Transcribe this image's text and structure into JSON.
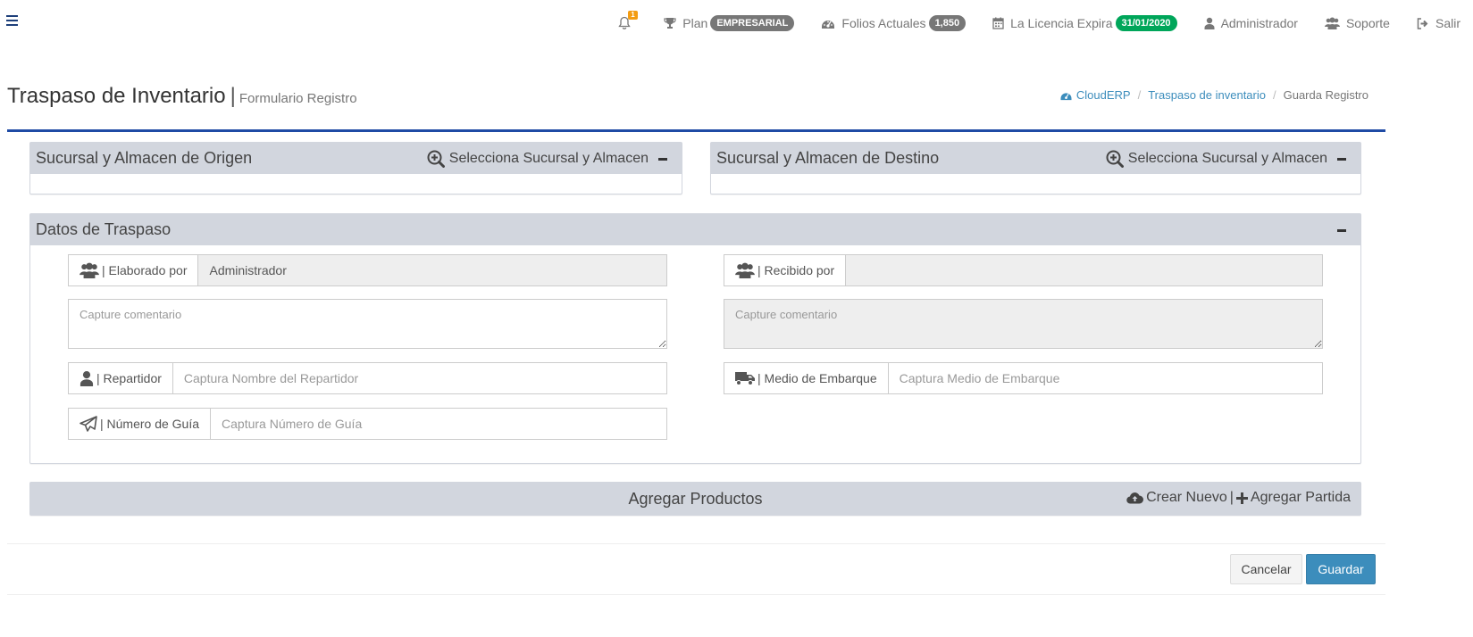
{
  "topbar": {
    "notifications_count": "1",
    "plan_label": "Plan",
    "plan_badge": "EMPRESARIAL",
    "folios_label": "Folios Actuales",
    "folios_badge": "1,850",
    "license_label": "La Licencia Expira",
    "license_badge": "31/01/2020",
    "user_label": "Administrador",
    "support_label": "Soporte",
    "logout_label": "Salir"
  },
  "header": {
    "title": "Traspaso de Inventario",
    "separator": "|",
    "subtitle": "Formulario Registro"
  },
  "breadcrumb": {
    "home": "CloudERP",
    "section": "Traspaso de inventario",
    "current": "Guarda Registro"
  },
  "origin_panel": {
    "title": "Sucursal y Almacen de Origen",
    "tool_label": "Selecciona Sucursal y Almacen"
  },
  "destination_panel": {
    "title": "Sucursal y Almacen de Destino",
    "tool_label": "Selecciona Sucursal y Almacen"
  },
  "transfer_panel": {
    "title": "Datos de Traspaso",
    "elaborado_label": "| Elaborado por",
    "elaborado_value": "Administrador",
    "recibido_label": "| Recibido por",
    "recibido_value": "",
    "comment_placeholder": "Capture comentario",
    "comment_received_placeholder": "Capture comentario",
    "repartidor_label": "| Repartidor",
    "repartidor_placeholder": "Captura Nombre del Repartidor",
    "medio_label": "| Medio de Embarque",
    "medio_placeholder": "Captura Medio de Embarque",
    "guia_label": "| Número de Guía",
    "guia_placeholder": "Captura Número de Guía"
  },
  "products_panel": {
    "title": "Agregar Productos",
    "create_label": "Crear Nuevo",
    "separator": "|",
    "add_label": "Agregar Partida"
  },
  "footer": {
    "cancel_label": "Cancelar",
    "save_label": "Guardar"
  },
  "colors": {
    "accent_blue": "#3c8dbc",
    "box_border": "#1f4ba5",
    "panel_header": "#d2d6de",
    "badge_grey": "#777777",
    "badge_green": "#00a65a",
    "notification": "#f39c12"
  },
  "icons": {
    "menu": "hamburger-icon",
    "notifications": "bell-icon",
    "plan": "trophy-icon",
    "folios": "dashboard-icon",
    "license": "calendar-icon",
    "user": "user-icon",
    "support": "users-icon",
    "logout": "sign-out-icon",
    "select": "search-plus-icon",
    "collapse": "minus-icon",
    "group": "users-icon",
    "driver": "user-icon",
    "shipping": "truck-icon",
    "guide": "paper-plane-icon",
    "create": "cloud-upload-icon",
    "add": "plus-icon"
  }
}
